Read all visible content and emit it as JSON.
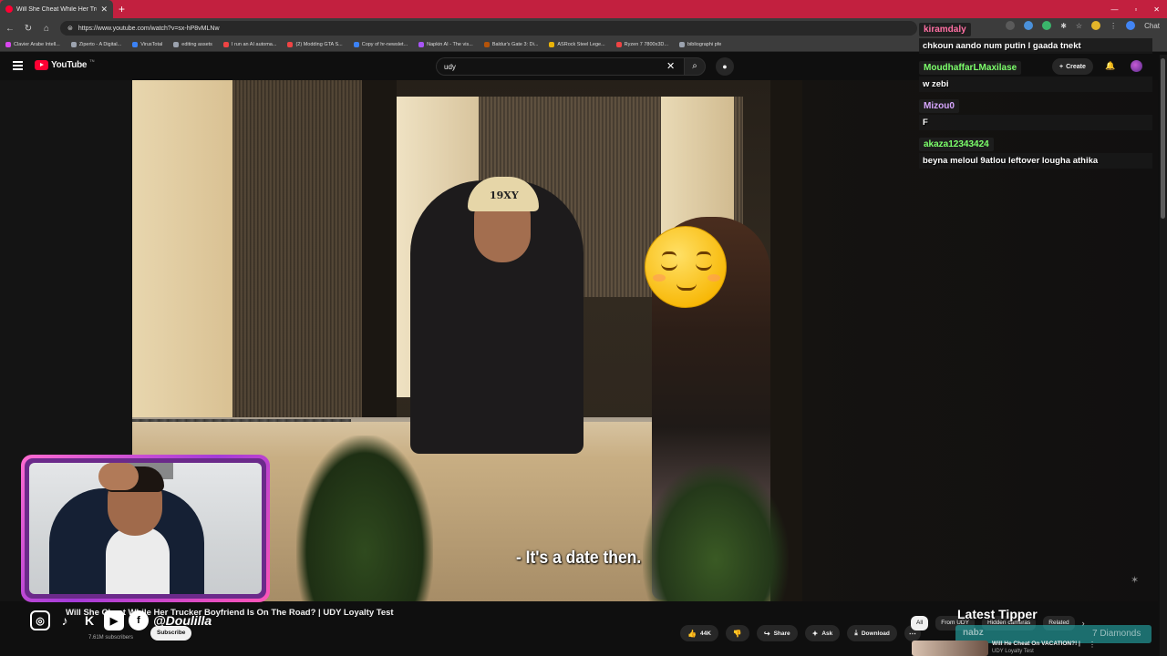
{
  "browser": {
    "tab_title": "Will She Cheat While Her Trucker",
    "new_tab": "+",
    "url": "https://www.youtube.com/watch?v=sx-hP8vMLNw",
    "chat_label": "Chat",
    "bookmarks": [
      "Clavier Arabe Intell...",
      "Ziperto - A Digital...",
      "VirusTotal",
      "editing assets",
      "I run an AI automa...",
      "(2) Modding GTA S...",
      "Copy of hr-newslet...",
      "Napkin AI - The vis...",
      "Baldur's Gate 3: Di...",
      "ASRock Steel Lege...",
      "Ryzen 7 7800x3D...",
      "bibliographi pfe"
    ]
  },
  "youtube": {
    "logo_text": "YouTube",
    "logo_tn": "TN",
    "search_value": "udy",
    "create_label": "Create"
  },
  "video": {
    "subtitle": "- It's a date then.",
    "cap_text": "19XY",
    "title": "Will She Cheat While Her Trucker Boyfriend Is On The Road? | UDY Loyalty Test",
    "subscribers": "7.61M subscribers",
    "subscribe_label": "Subscribe",
    "likes": "44K",
    "share_label": "Share",
    "ask_label": "Ask",
    "download_label": "Download"
  },
  "overlay": {
    "handle": "@Doulilla",
    "chat": [
      {
        "user": "kiramdaly",
        "text": "chkoun aando num putin l gaada tnekt"
      },
      {
        "user": "MoudhaffarLMaxilase",
        "text": "w zebi"
      },
      {
        "user": "Mizou0",
        "text": "F"
      },
      {
        "user": "akaza12343424",
        "text": "beyna meloul 9atlou leftover lougha athika"
      }
    ],
    "tipper_heading": "Latest Tipper",
    "tipper_name": "nabz",
    "tipper_amount": "7 Diamonds"
  },
  "filters": [
    "All",
    "From UDY",
    "Hidden cameras",
    "Related"
  ],
  "related": {
    "title": "Will He Cheat On VACATION?! |",
    "channel": "UDY Loyalty Test"
  },
  "colors": {
    "tabstrip": "#c2203f",
    "youtube_red": "#ff0033",
    "cam_border": "#ff6bd0"
  }
}
